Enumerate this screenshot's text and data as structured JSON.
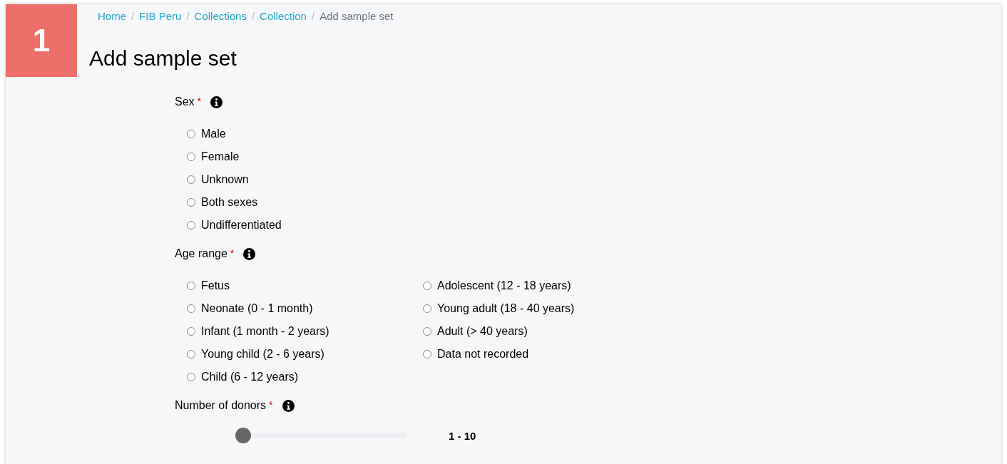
{
  "step_badge": "1",
  "breadcrumb": [
    {
      "label": "Home",
      "link": true
    },
    {
      "label": "FIB Peru",
      "link": true
    },
    {
      "label": "Collections",
      "link": true
    },
    {
      "label": "Collection",
      "link": true
    },
    {
      "label": "Add sample set",
      "link": false
    }
  ],
  "breadcrumb_separator": "/",
  "title": "Add sample set",
  "fields": [
    {
      "kind": "radio",
      "label": "Sex",
      "required_mark": "*",
      "options": [
        {
          "label": "Male",
          "selected": false
        },
        {
          "label": "Female",
          "selected": false
        },
        {
          "label": "Unknown",
          "selected": false
        },
        {
          "label": "Both sexes",
          "selected": false
        },
        {
          "label": "Undifferentiated",
          "selected": false
        }
      ]
    },
    {
      "kind": "radio",
      "label": "Age range",
      "required_mark": "*",
      "options": [
        {
          "label": "Fetus",
          "selected": false
        },
        {
          "label": "Neonate (0 - 1 month)",
          "selected": false
        },
        {
          "label": "Infant (1 month - 2 years)",
          "selected": false
        },
        {
          "label": "Young child (2 - 6 years)",
          "selected": false
        },
        {
          "label": "Child (6 - 12 years)",
          "selected": false
        },
        {
          "label": "Adolescent (12 - 18 years)",
          "selected": false
        },
        {
          "label": "Young adult (18 - 40 years)",
          "selected": false
        },
        {
          "label": "Adult (> 40 years)",
          "selected": false
        },
        {
          "label": "Data not recorded",
          "selected": false
        }
      ]
    },
    {
      "kind": "slider",
      "label": "Number of donors",
      "required_mark": "*",
      "level": 0,
      "reading": "1 - 10"
    }
  ]
}
